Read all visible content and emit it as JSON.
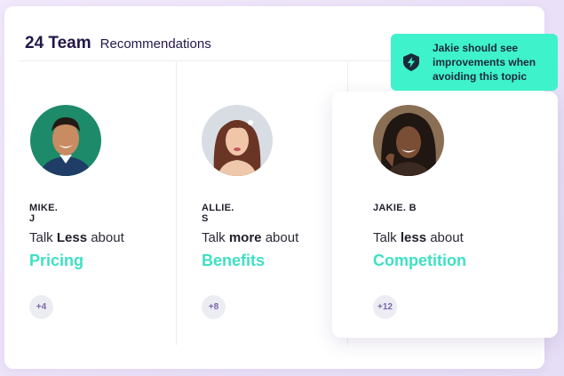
{
  "header": {
    "team_count": "24 Team",
    "subtitle": "Recommendations"
  },
  "members": [
    {
      "name": "MIKE. J",
      "advice_prefix": "Talk ",
      "advice_emphasis": "Less",
      "advice_suffix": " about",
      "topic": "Pricing",
      "more": "+4"
    },
    {
      "name": "ALLIE. S",
      "advice_prefix": "Talk ",
      "advice_emphasis": "more",
      "advice_suffix": " about",
      "topic": "Benefits",
      "more": "+8"
    },
    {
      "name": "JAKIE. B",
      "advice_prefix": "Talk ",
      "advice_emphasis": "less",
      "advice_suffix": " about",
      "topic": "Competition",
      "more": "+12"
    }
  ],
  "tooltip": {
    "line1": "Jakie should see",
    "line2": "improvements when",
    "line3": "avoiding this topic",
    "icon": "lightning-shield-icon"
  },
  "colors": {
    "accent": "#3ee0c3",
    "tooltip_bg": "#3ef2cc",
    "title": "#22174a",
    "badge_text": "#7b67a8"
  }
}
